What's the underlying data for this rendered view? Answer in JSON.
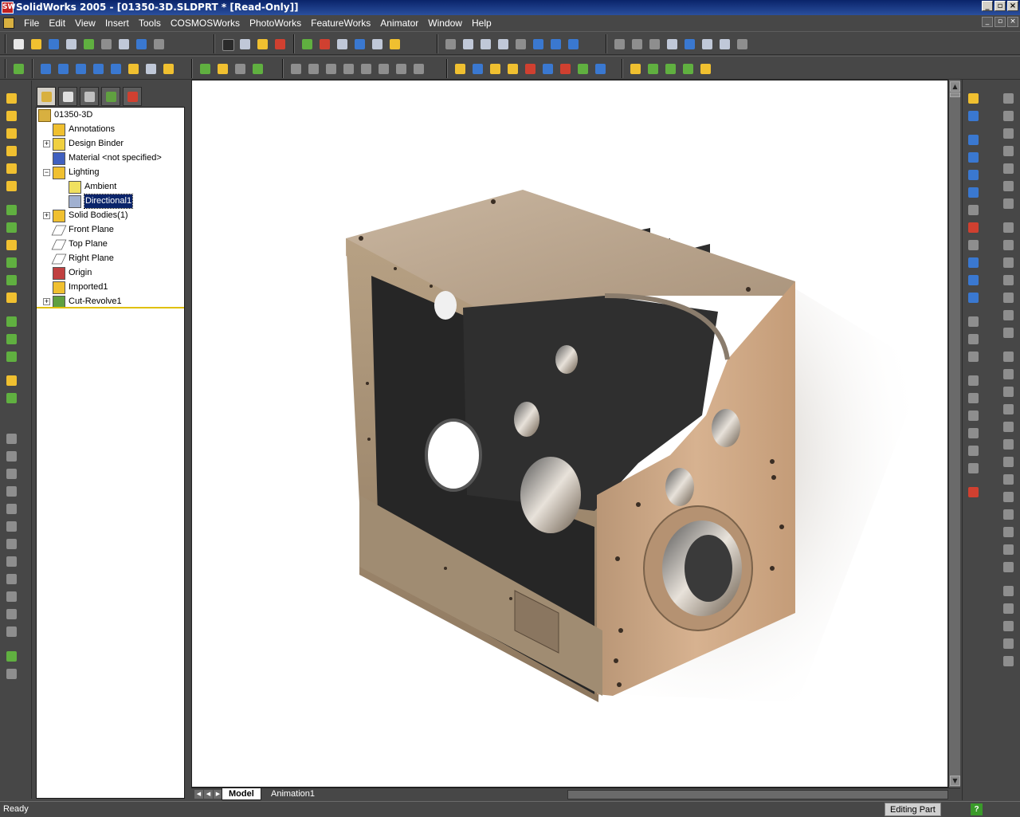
{
  "window": {
    "title": "SolidWorks 2005 - [01350-3D.SLDPRT * [Read-Only]]",
    "app_icon_text": "SW"
  },
  "window_buttons": {
    "minimize": "_",
    "maximize": "▫",
    "close": "×"
  },
  "menu": [
    "File",
    "Edit",
    "View",
    "Insert",
    "Tools",
    "COSMOSWorks",
    "PhotoWorks",
    "FeatureWorks",
    "Animator",
    "Window",
    "Help"
  ],
  "tree": {
    "root": "01350-3D",
    "items": [
      {
        "label": "Annotations",
        "icon": "annotations-icon",
        "expander": ""
      },
      {
        "label": "Design Binder",
        "icon": "design-binder-icon",
        "expander": "+"
      },
      {
        "label": "Material <not specified>",
        "icon": "material-icon",
        "expander": ""
      },
      {
        "label": "Lighting",
        "icon": "lighting-folder-icon",
        "expander": "−"
      },
      {
        "label": "Ambient",
        "icon": "ambient-light-icon",
        "expander": "",
        "indent": 1
      },
      {
        "label": "Directional1",
        "icon": "directional-light-icon",
        "expander": "",
        "indent": 1,
        "selected": true
      },
      {
        "label": "Solid Bodies(1)",
        "icon": "solid-bodies-icon",
        "expander": "+"
      },
      {
        "label": "Front Plane",
        "icon": "plane-icon",
        "expander": ""
      },
      {
        "label": "Top Plane",
        "icon": "plane-icon",
        "expander": ""
      },
      {
        "label": "Right Plane",
        "icon": "plane-icon",
        "expander": ""
      },
      {
        "label": "Origin",
        "icon": "origin-icon",
        "expander": ""
      },
      {
        "label": "Imported1",
        "icon": "imported-feature-icon",
        "expander": ""
      },
      {
        "label": "Cut-Revolve1",
        "icon": "cut-revolve-icon",
        "expander": "+"
      }
    ]
  },
  "tabs": {
    "model": "Model",
    "animation": "Animation1"
  },
  "status": {
    "left": "Ready",
    "mode": "Editing Part",
    "help": "?"
  },
  "colors": {
    "background": "#474747",
    "selection": "#0a246a",
    "part_tan": "#c9b397",
    "part_dark": "#2a2a2a"
  }
}
